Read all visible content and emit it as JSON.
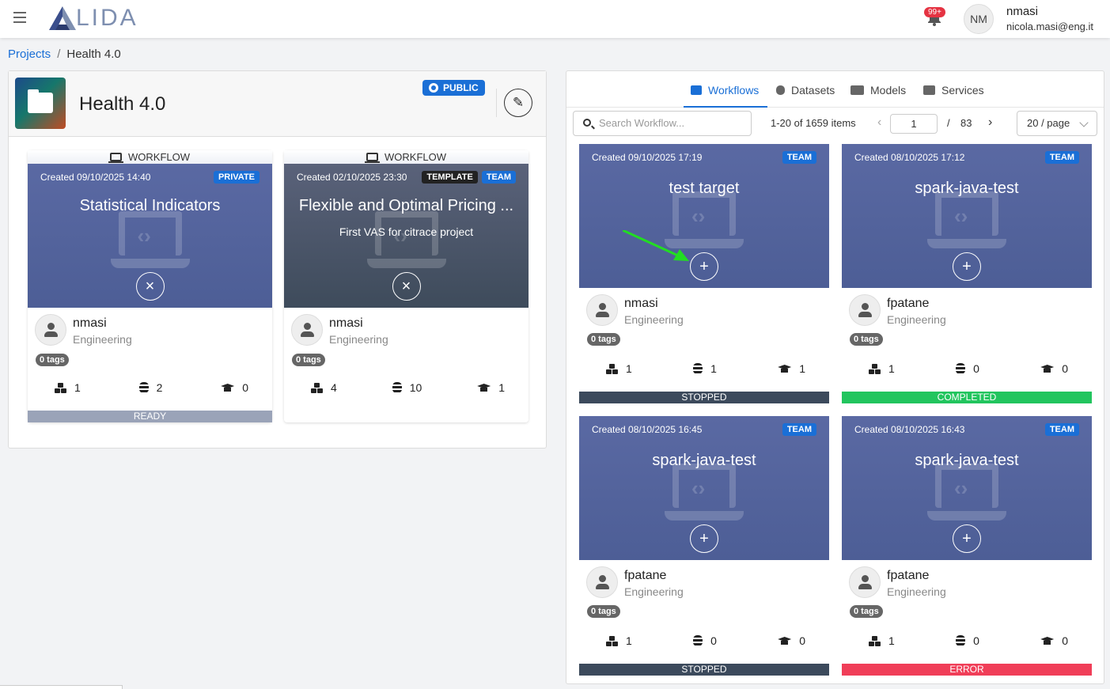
{
  "app": {
    "logo_text": "LIDA"
  },
  "notifications": {
    "count": "99+"
  },
  "user": {
    "initials": "NM",
    "name": "nmasi",
    "email": "nicola.masi@eng.it"
  },
  "breadcrumb": {
    "projects": "Projects",
    "separator": "/",
    "current": "Health 4.0"
  },
  "project": {
    "title": "Health 4.0",
    "visibility": "PUBLIC"
  },
  "project_workflows": [
    {
      "kind": "WORKFLOW",
      "created": "Created 09/10/2025 14:40",
      "badges": [
        "PRIVATE"
      ],
      "title": "Statistical Indicators",
      "subtitle": "",
      "owner": "nmasi",
      "dept": "Engineering",
      "tags": "0 tags",
      "stats": [
        "1",
        "2",
        "0"
      ],
      "status": "READY",
      "status_color": "#9aa3b8"
    },
    {
      "kind": "WORKFLOW",
      "created": "Created 02/10/2025 23:30",
      "badges": [
        "TEMPLATE",
        "TEAM"
      ],
      "title": "Flexible and Optimal Pricing ...",
      "subtitle": "First VAS for citrace project",
      "owner": "nmasi",
      "dept": "Engineering",
      "tags": "0 tags",
      "stats": [
        "4",
        "10",
        "1"
      ],
      "status": "",
      "status_color": ""
    }
  ],
  "tabs": [
    {
      "label": "Workflows",
      "active": true
    },
    {
      "label": "Datasets",
      "active": false
    },
    {
      "label": "Models",
      "active": false
    },
    {
      "label": "Services",
      "active": false
    }
  ],
  "search": {
    "placeholder": "Search Workflow..."
  },
  "pagination": {
    "info": "1-20 of 1659 items",
    "current": "1",
    "separator": "/",
    "total": "83",
    "page_size": "20 / page"
  },
  "workflows": [
    {
      "created": "Created 09/10/2025 17:19",
      "badge": "TEAM",
      "title": "test target",
      "owner": "nmasi",
      "dept": "Engineering",
      "tags": "0 tags",
      "stats": [
        "1",
        "1",
        "1"
      ],
      "status": "STOPPED",
      "status_color": "#3c4a5c"
    },
    {
      "created": "Created 08/10/2025 17:12",
      "badge": "TEAM",
      "title": "spark-java-test",
      "owner": "fpatane",
      "dept": "Engineering",
      "tags": "0 tags",
      "stats": [
        "1",
        "0",
        "0"
      ],
      "status": "COMPLETED",
      "status_color": "#22c55e"
    },
    {
      "created": "Created 08/10/2025 16:45",
      "badge": "TEAM",
      "title": "spark-java-test",
      "owner": "fpatane",
      "dept": "Engineering",
      "tags": "0 tags",
      "stats": [
        "1",
        "0",
        "0"
      ],
      "status": "STOPPED",
      "status_color": "#3c4a5c"
    },
    {
      "created": "Created 08/10/2025 16:43",
      "badge": "TEAM",
      "title": "spark-java-test",
      "owner": "fpatane",
      "dept": "Engineering",
      "tags": "0 tags",
      "stats": [
        "1",
        "0",
        "0"
      ],
      "status": "ERROR",
      "status_color": "#f03e58"
    }
  ]
}
